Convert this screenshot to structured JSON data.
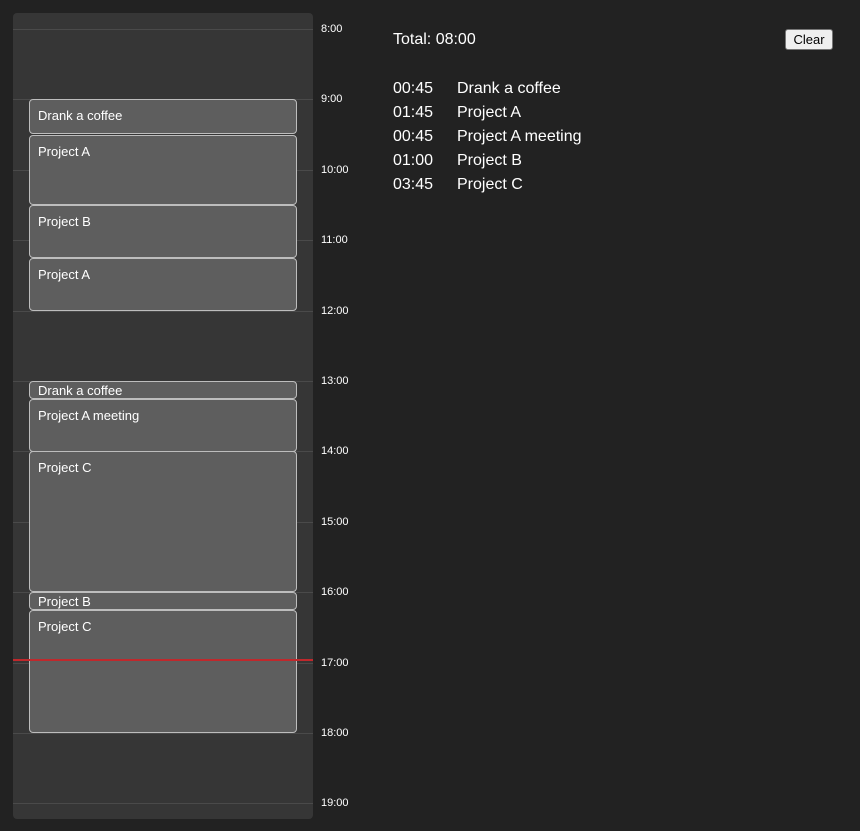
{
  "timeline": {
    "hours": [
      "8:00",
      "9:00",
      "10:00",
      "11:00",
      "12:00",
      "13:00",
      "14:00",
      "15:00",
      "16:00",
      "17:00",
      "18:00",
      "19:00"
    ],
    "events": [
      {
        "title": "Drank a coffee",
        "start": "9:00",
        "end": "9:30"
      },
      {
        "title": "Project A",
        "start": "9:30",
        "end": "10:30"
      },
      {
        "title": "Project B",
        "start": "10:30",
        "end": "11:15"
      },
      {
        "title": "Project A",
        "start": "11:15",
        "end": "12:00"
      },
      {
        "title": "Drank a coffee",
        "start": "13:00",
        "end": "13:15"
      },
      {
        "title": "Project A meeting",
        "start": "13:15",
        "end": "14:00"
      },
      {
        "title": "Project C",
        "start": "14:00",
        "end": "16:00"
      },
      {
        "title": "Project B",
        "start": "16:00",
        "end": "16:15"
      },
      {
        "title": "Project C",
        "start": "16:15",
        "end": "18:00"
      }
    ],
    "current_time": "16:56",
    "current_time_color": "#c0282c"
  },
  "summary": {
    "total_label": "Total: 08:00",
    "clear_label": "Clear",
    "items": [
      {
        "duration": "00:45",
        "name": "Drank a coffee"
      },
      {
        "duration": "01:45",
        "name": "Project A"
      },
      {
        "duration": "00:45",
        "name": "Project A meeting"
      },
      {
        "duration": "01:00",
        "name": "Project B"
      },
      {
        "duration": "03:45",
        "name": "Project C"
      }
    ]
  }
}
